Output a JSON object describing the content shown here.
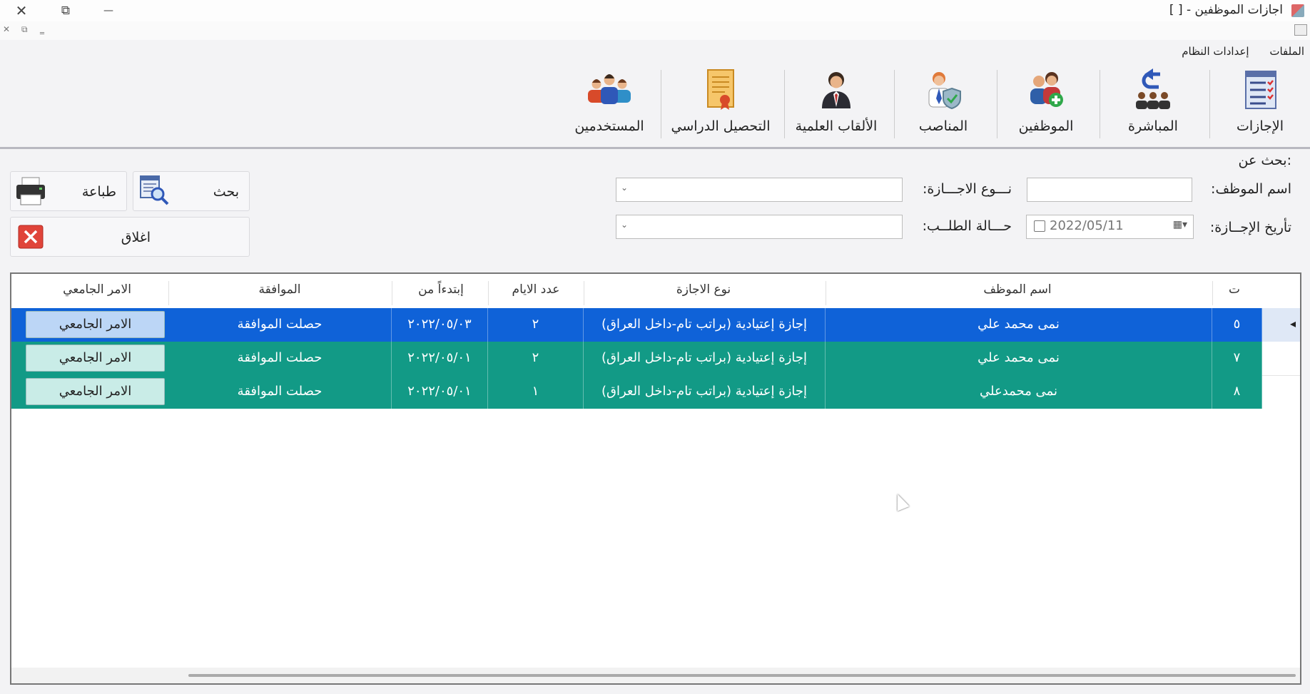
{
  "window": {
    "title": "اجازات الموظفين - [ ]",
    "close_glyph": "✕",
    "restore_glyph": "⧉",
    "minimize_glyph": "—",
    "mdi_close": "✕",
    "mdi_restore": "⧉",
    "mdi_min": "‗"
  },
  "menu": {
    "items": [
      "الملفات",
      "إعدادات النظام"
    ]
  },
  "toolbar": {
    "buttons": [
      {
        "label": "الإجازات",
        "icon": "checklist-icon"
      },
      {
        "label": "المباشرة",
        "icon": "return-group-icon"
      },
      {
        "label": "الموظفين",
        "icon": "add-employee-icon"
      },
      {
        "label": "المناصب",
        "icon": "position-shield-icon"
      },
      {
        "label": "الألقاب العلمية",
        "icon": "scholar-icon"
      },
      {
        "label": "التحصيل الدراسي",
        "icon": "certificate-icon"
      },
      {
        "label": "المستخدمين",
        "icon": "users-group-icon"
      }
    ]
  },
  "search": {
    "heading": "بحث عن:",
    "employee_name_label": "اسم الموظف:",
    "employee_name_value": "",
    "leave_type_label": "نـــوع الاجـــازة:",
    "leave_type_value": "",
    "leave_date_label": "تأريخ الإجــازة:",
    "leave_date_value": "2022/05/11",
    "request_status_label": "حـــالة الطلــب:",
    "request_status_value": "",
    "combo_arrow": "⌄",
    "calendar_glyph": "▦▾"
  },
  "actions": {
    "search_label": "بحث",
    "print_label": "طباعة",
    "close_label": "اغلاق"
  },
  "grid": {
    "columns": [
      "ت",
      "اسم الموظف",
      "نوع الاجازة",
      "عدد الايام",
      "إبتدءاً من",
      "الموافقة",
      "الامر الجامعي"
    ],
    "rows": [
      {
        "no": "٥",
        "name": "نمى محمد علي",
        "type": "إجازة إعتيادية (براتب تام-داخل العراق)",
        "days": "٢",
        "from": "٢٠٢٢/٠٥/٠٣",
        "approval": "حصلت الموافقة",
        "order": "الامر الجامعي",
        "selected": true
      },
      {
        "no": "٧",
        "name": "نمى محمد علي",
        "type": "إجازة إعتيادية (براتب تام-داخل العراق)",
        "days": "٢",
        "from": "٢٠٢٢/٠٥/٠١",
        "approval": "حصلت الموافقة",
        "order": "الامر الجامعي",
        "selected": false
      },
      {
        "no": "٨",
        "name": "نمى محمدعلي",
        "type": "إجازة إعتيادية (براتب تام-داخل العراق)",
        "days": "١",
        "from": "٢٠٢٢/٠٥/٠١",
        "approval": "حصلت الموافقة",
        "order": "الامر الجامعي",
        "selected": false
      }
    ],
    "current_row_marker": "◂"
  },
  "colors": {
    "selected_row": "#0f62d8",
    "normal_row": "#129a86",
    "order_button_selected": "#bcd6f6",
    "order_button_normal": "#c9ece7"
  }
}
